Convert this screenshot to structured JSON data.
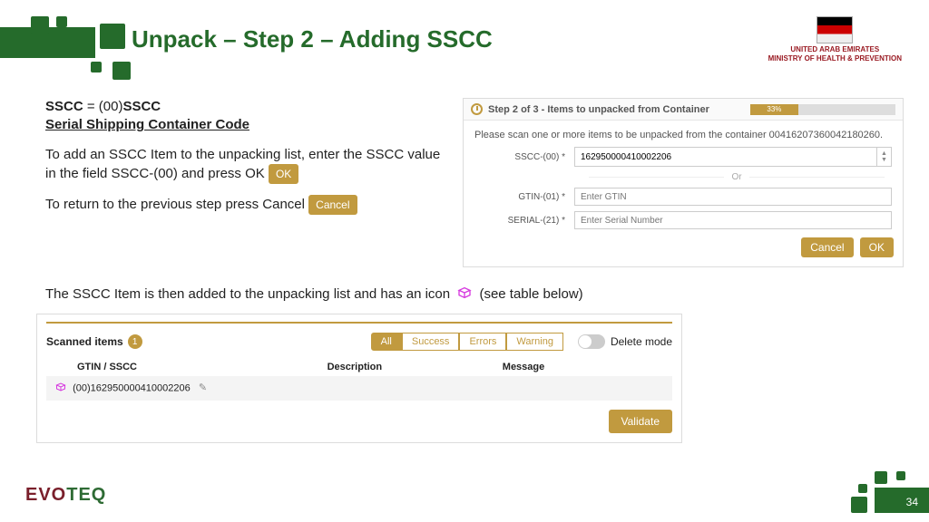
{
  "title": "Unpack – Step 2 – Adding SSCC",
  "gov": {
    "line1": "UNITED ARAB EMIRATES",
    "line2": "MINISTRY OF HEALTH & PREVENTION"
  },
  "left": {
    "sscc_prefix": "SSCC",
    "sscc_eq": " = (00)",
    "sscc_bold": "SSCC",
    "subtitle": "Serial Shipping Container Code",
    "p1": "To add an SSCC Item to the unpacking list, enter the SSCC value in the field SSCC-(00) and press OK",
    "ok_label": "OK",
    "p2": "To return to the previous step press Cancel",
    "cancel_label": "Cancel"
  },
  "form": {
    "step_title": "Step 2 of 3 - Items to unpacked from Container",
    "progress_pct": "33%",
    "instruction": "Please scan one or more items to be unpacked from the container 00416207360042180260.",
    "sscc_label": "SSCC-(00) *",
    "sscc_value": "162950000410002206",
    "or": "Or",
    "gtin_label": "GTIN-(01) *",
    "gtin_placeholder": "Enter GTIN",
    "serial_label": "SERIAL-(21) *",
    "serial_placeholder": "Enter Serial Number",
    "cancel": "Cancel",
    "ok": "OK"
  },
  "mid": {
    "text_a": "The SSCC Item is then added to the unpacking list and has an icon",
    "text_b": "(see table below)"
  },
  "table": {
    "heading": "Scanned items",
    "count": "1",
    "filters": {
      "all": "All",
      "success": "Success",
      "errors": "Errors",
      "warning": "Warning"
    },
    "delete_mode": "Delete mode",
    "cols": {
      "c1": "GTIN / SSCC",
      "c2": "Description",
      "c3": "Message"
    },
    "row1_sscc": "(00)162950000410002206",
    "validate": "Validate"
  },
  "footer_logo": {
    "a": "EVO",
    "b": "TEQ"
  },
  "page_num": "34"
}
